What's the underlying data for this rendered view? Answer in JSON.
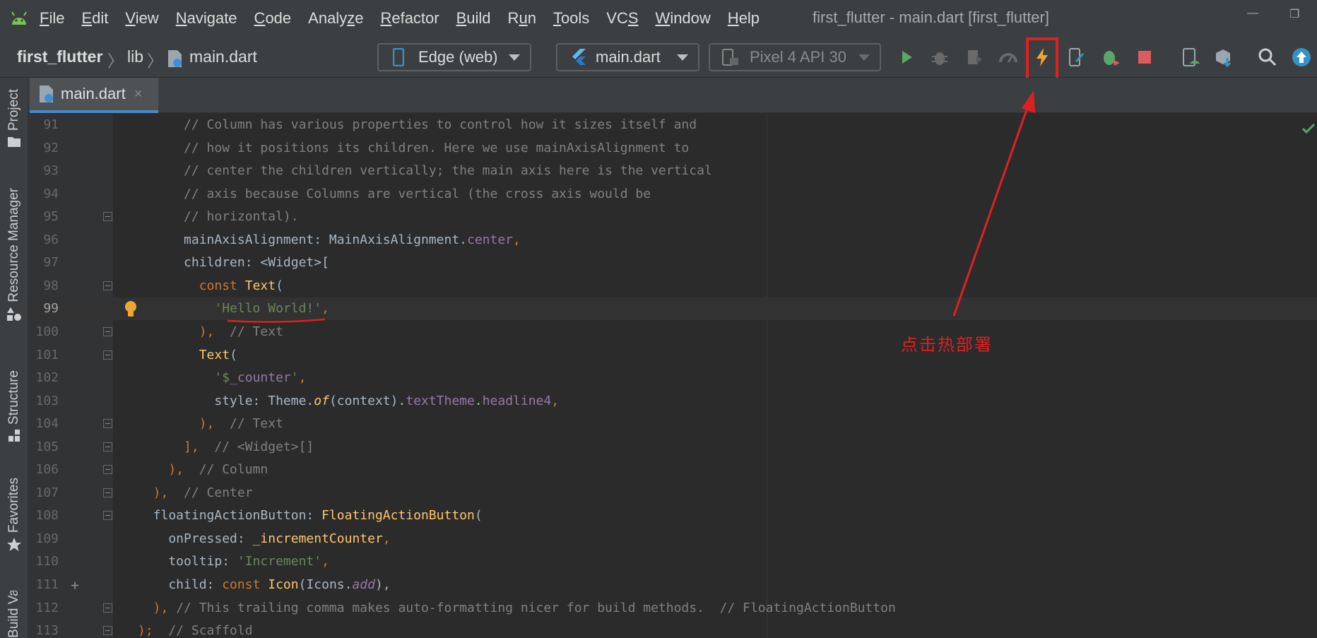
{
  "menubar": {
    "items": [
      {
        "pre": "",
        "u": "F",
        "post": "ile"
      },
      {
        "pre": "",
        "u": "E",
        "post": "dit"
      },
      {
        "pre": "",
        "u": "V",
        "post": "iew"
      },
      {
        "pre": "",
        "u": "N",
        "post": "avigate"
      },
      {
        "pre": "",
        "u": "C",
        "post": "ode"
      },
      {
        "pre": "Analy",
        "u": "z",
        "post": "e"
      },
      {
        "pre": "",
        "u": "R",
        "post": "efactor"
      },
      {
        "pre": "",
        "u": "B",
        "post": "uild"
      },
      {
        "pre": "R",
        "u": "u",
        "post": "n"
      },
      {
        "pre": "",
        "u": "T",
        "post": "ools"
      },
      {
        "pre": "VC",
        "u": "S",
        "post": ""
      },
      {
        "pre": "",
        "u": "W",
        "post": "indow"
      },
      {
        "pre": "",
        "u": "H",
        "post": "elp"
      }
    ],
    "window_title": "first_flutter - main.dart [first_flutter]"
  },
  "navbar": {
    "project": "first_flutter",
    "folder": "lib",
    "file": "main.dart",
    "device": "Edge (web)",
    "run_config": "main.dart",
    "emulator": "Pixel 4 API 30"
  },
  "toolbar_icons": [
    "run-icon",
    "debug-icon",
    "profile-icon",
    "performance-icon",
    "hot-reload-icon",
    "device-manager-icon",
    "attach-debugger-icon",
    "stop-icon",
    "avd-manager-icon",
    "sdk-manager-icon",
    "search-icon",
    "update-icon"
  ],
  "sidebar": {
    "project": "Project",
    "resource_manager": "Resource Manager",
    "structure": "Structure",
    "favorites": "Favorites",
    "build_variants": "Build Variants"
  },
  "tab": {
    "name": "main.dart",
    "close": "×"
  },
  "annotation": "点击热部署",
  "colors": {
    "accent": "#e02020",
    "run": "#59a869",
    "stop": "#db5c5c",
    "hot_reload": "#f0a732"
  },
  "lines": [
    {
      "n": "91",
      "fold": false,
      "segs": [
        [
          "      ",
          ""
        ],
        [
          "// Column has various properties to control how it sizes itself and",
          "c"
        ]
      ]
    },
    {
      "n": "92",
      "fold": false,
      "segs": [
        [
          "      ",
          ""
        ],
        [
          "// how it positions its children. Here we use mainAxisAlignment to",
          "c"
        ]
      ]
    },
    {
      "n": "93",
      "fold": false,
      "segs": [
        [
          "      ",
          ""
        ],
        [
          "// center the children vertically; the main axis here is the vertical",
          "c"
        ]
      ]
    },
    {
      "n": "94",
      "fold": false,
      "segs": [
        [
          "      ",
          ""
        ],
        [
          "// axis because Columns are vertical (the cross axis would be",
          "c"
        ]
      ]
    },
    {
      "n": "95",
      "fold": true,
      "segs": [
        [
          "      ",
          ""
        ],
        [
          "// horizontal).",
          "c"
        ]
      ]
    },
    {
      "n": "96",
      "fold": false,
      "segs": [
        [
          "      mainAxisAlignment: MainAxisAlignment.",
          ""
        ],
        [
          "center",
          "p"
        ],
        [
          ",",
          "k"
        ]
      ]
    },
    {
      "n": "97",
      "fold": false,
      "segs": [
        [
          "      children: <Widget>[",
          ""
        ]
      ]
    },
    {
      "n": "98",
      "fold": true,
      "segs": [
        [
          "        ",
          ""
        ],
        [
          "const ",
          "k"
        ],
        [
          "Text",
          "f"
        ],
        [
          "(",
          ""
        ]
      ]
    },
    {
      "n": "99",
      "fold": false,
      "cur": true,
      "bulb": true,
      "segs": [
        [
          "          ",
          ""
        ],
        [
          "'Hello World!'",
          "s"
        ],
        [
          ",",
          "k"
        ]
      ]
    },
    {
      "n": "100",
      "fold": true,
      "segs": [
        [
          "        ),",
          "k"
        ],
        [
          "  // Text",
          "c"
        ]
      ]
    },
    {
      "n": "101",
      "fold": true,
      "segs": [
        [
          "        ",
          ""
        ],
        [
          "Text",
          "f"
        ],
        [
          "(",
          ""
        ]
      ]
    },
    {
      "n": "102",
      "fold": false,
      "segs": [
        [
          "          ",
          ""
        ],
        [
          "'$",
          "s"
        ],
        [
          "_counter",
          "p"
        ],
        [
          "'",
          "s"
        ],
        [
          ",",
          "k"
        ]
      ]
    },
    {
      "n": "103",
      "fold": false,
      "segs": [
        [
          "          style: Theme.",
          ""
        ],
        [
          "of",
          "i"
        ],
        [
          "(context).",
          ""
        ],
        [
          "textTheme",
          "p"
        ],
        [
          ".",
          ""
        ],
        [
          "headline4",
          "p"
        ],
        [
          ",",
          "k"
        ]
      ]
    },
    {
      "n": "104",
      "fold": true,
      "segs": [
        [
          "        ),",
          "k"
        ],
        [
          "  // Text",
          "c"
        ]
      ]
    },
    {
      "n": "105",
      "fold": true,
      "segs": [
        [
          "      ],",
          "k"
        ],
        [
          "  // <Widget>[]",
          "c"
        ]
      ]
    },
    {
      "n": "106",
      "fold": true,
      "segs": [
        [
          "    ),",
          "k"
        ],
        [
          "  // Column",
          "c"
        ]
      ]
    },
    {
      "n": "107",
      "fold": true,
      "segs": [
        [
          "  ),",
          "k"
        ],
        [
          "  // Center",
          "c"
        ]
      ]
    },
    {
      "n": "108",
      "fold": true,
      "segs": [
        [
          "  floatingActionButton: ",
          ""
        ],
        [
          "FloatingActionButton",
          "f"
        ],
        [
          "(",
          ""
        ]
      ]
    },
    {
      "n": "109",
      "fold": false,
      "segs": [
        [
          "    onPressed: ",
          ""
        ],
        [
          "_incrementCounter",
          "f"
        ],
        [
          ",",
          "k"
        ]
      ]
    },
    {
      "n": "110",
      "fold": false,
      "segs": [
        [
          "    tooltip: ",
          ""
        ],
        [
          "'Increment'",
          "s"
        ],
        [
          ",",
          "k"
        ]
      ]
    },
    {
      "n": "111",
      "fold": false,
      "plus": true,
      "segs": [
        [
          "    child: ",
          ""
        ],
        [
          "const ",
          "k"
        ],
        [
          "Icon",
          "f"
        ],
        [
          "(Icons.",
          ""
        ],
        [
          "add",
          "pi"
        ],
        [
          "),",
          ""
        ]
      ]
    },
    {
      "n": "112",
      "fold": true,
      "segs": [
        [
          "  ), ",
          "k"
        ],
        [
          "// This trailing comma makes auto-formatting nicer for build methods.  // FloatingActionButton",
          "c"
        ]
      ]
    },
    {
      "n": "113",
      "fold": true,
      "segs": [
        [
          ");",
          "k"
        ],
        [
          "  // Scaffold",
          "c"
        ]
      ]
    }
  ]
}
